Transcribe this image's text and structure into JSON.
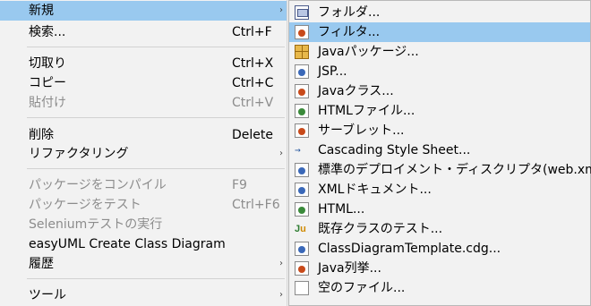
{
  "context_menu": {
    "items": [
      {
        "label": "新規",
        "shortcut": "",
        "arrow": "›"
      },
      {
        "label": "検索...",
        "shortcut": "Ctrl+F"
      },
      {
        "label": "切取り",
        "shortcut": "Ctrl+X"
      },
      {
        "label": "コピー",
        "shortcut": "Ctrl+C"
      },
      {
        "label": "貼付け",
        "shortcut": "Ctrl+V"
      },
      {
        "label": "削除",
        "shortcut": "Delete"
      },
      {
        "label": "リファクタリング",
        "shortcut": "",
        "arrow": "›"
      },
      {
        "label": "パッケージをコンパイル",
        "shortcut": "F9"
      },
      {
        "label": "パッケージをテスト",
        "shortcut": "Ctrl+F6"
      },
      {
        "label": "Seleniumテストの実行",
        "shortcut": ""
      },
      {
        "label": "easyUML Create Class Diagram",
        "shortcut": ""
      },
      {
        "label": "履歴",
        "shortcut": "",
        "arrow": "›"
      },
      {
        "label": "ツール",
        "shortcut": "",
        "arrow": "›"
      }
    ]
  },
  "submenu": {
    "items": [
      {
        "label": "フォルダ...",
        "icon": "folder-icon"
      },
      {
        "label": "フィルタ...",
        "icon": "filter-file-icon"
      },
      {
        "label": "Javaパッケージ...",
        "icon": "java-package-icon"
      },
      {
        "label": "JSP...",
        "icon": "jsp-file-icon"
      },
      {
        "label": "Javaクラス...",
        "icon": "java-class-icon"
      },
      {
        "label": "HTMLファイル...",
        "icon": "html-file-icon"
      },
      {
        "label": "サーブレット...",
        "icon": "servlet-icon"
      },
      {
        "label": "Cascading Style Sheet...",
        "icon": "css-icon"
      },
      {
        "label": "標準のデプロイメント・ディスクリプタ(web.xml)...",
        "icon": "deployment-descriptor-icon"
      },
      {
        "label": "XMLドキュメント...",
        "icon": "xml-document-icon"
      },
      {
        "label": "HTML...",
        "icon": "html-icon"
      },
      {
        "label": "既存クラスのテスト...",
        "icon": "junit-icon"
      },
      {
        "label": "ClassDiagramTemplate.cdg...",
        "icon": "class-diagram-icon"
      },
      {
        "label": "Java列挙...",
        "icon": "java-enum-icon"
      },
      {
        "label": "空のファイル...",
        "icon": "empty-file-icon"
      }
    ]
  }
}
